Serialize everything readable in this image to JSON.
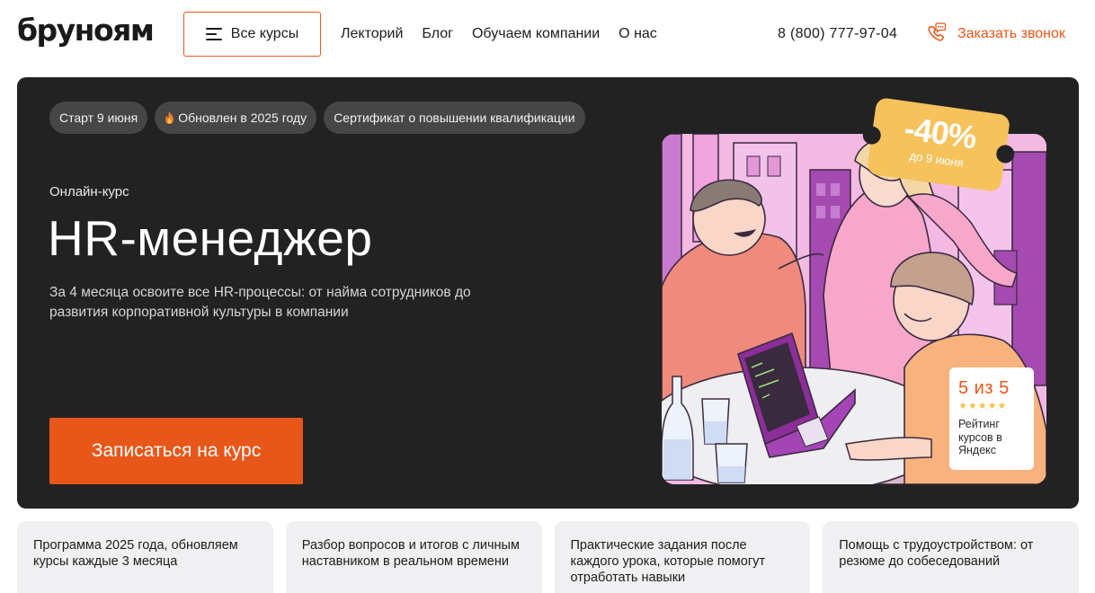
{
  "header": {
    "logo": "бруноям",
    "all_courses_label": "Все курсы",
    "nav": [
      {
        "label": "Лекторий"
      },
      {
        "label": "Блог"
      },
      {
        "label": "Обучаем компании"
      },
      {
        "label": "О нас"
      }
    ],
    "phone": "8 (800) 777-97-04",
    "callback_label": "Заказать звонок"
  },
  "hero": {
    "tags": [
      {
        "label": "Старт 9 июня"
      },
      {
        "label": "Обновлен в 2025 году"
      },
      {
        "label": "Сертификат о повышении квалификации"
      }
    ],
    "eyebrow": "Онлайн-курс",
    "title": "HR-менеджер",
    "description": "За 4 месяца освоите все HR-процессы: от найма сотрудников до развития корпоративной культуры в компании",
    "cta_label": "Записаться на курс",
    "discount": {
      "percent": "-40%",
      "until": "до 9 июня"
    },
    "rating": {
      "score": "5 из 5",
      "stars": 5,
      "label": "Рейтинг курсов в Яндекс"
    }
  },
  "features": [
    {
      "text": "Программа 2025 года, обновляем курсы каждые 3 месяца"
    },
    {
      "text": "Разбор вопросов и итогов с личным наставником в реальном времени"
    },
    {
      "text": "Практические задания после каждого урока, которые помогут отработать навыки"
    },
    {
      "text": "Помощь с трудоустройством: от резюме до собеседований"
    }
  ],
  "colors": {
    "accent": "#e8571a",
    "hero_bg": "#222222",
    "tag_bg": "#464646",
    "badge": "#f6c25c",
    "card_bg": "#f0f0f2"
  },
  "icons": {
    "menu": "burger-icon",
    "callback": "phone-chat-icon",
    "tag_flame": "flame-icon",
    "rating_stars": "star-icon"
  }
}
